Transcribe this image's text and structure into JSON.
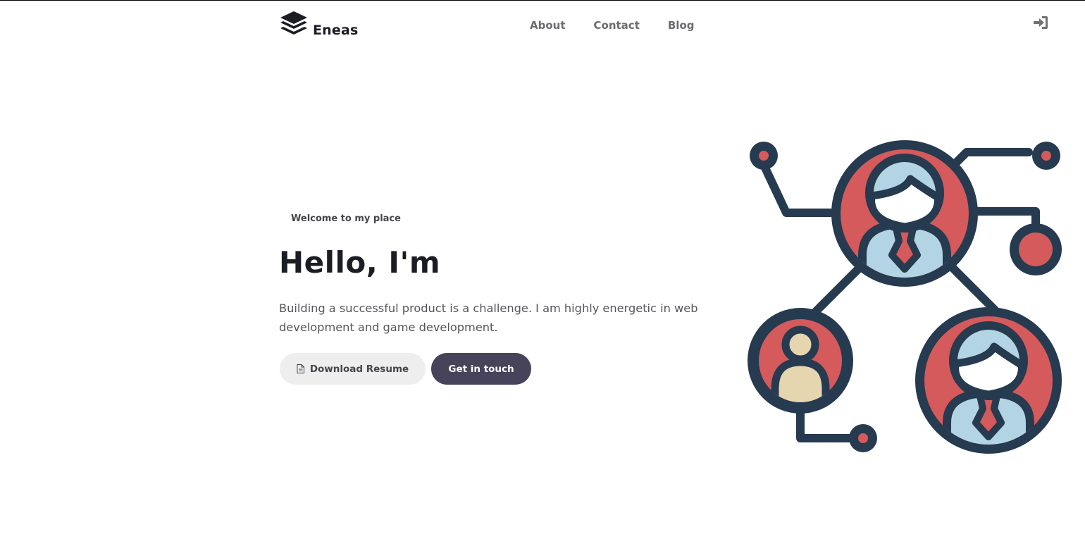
{
  "header": {
    "brand": "Eneas",
    "nav": [
      "About",
      "Contact",
      "Blog"
    ],
    "login_icon": "sign-in-icon"
  },
  "hero": {
    "eyebrow": "Welcome to my place",
    "headline": "Hello, I'm",
    "description": "Building a successful product is a challenge. I am highly energetic in web development and game development.",
    "buttons": {
      "resume": "Download Resume",
      "touch": "Get in touch"
    }
  },
  "colors": {
    "dark_navy": "#263a50",
    "red": "#d45a5c",
    "light_blue": "#b3d5e3",
    "beige": "#e5d6af",
    "button_dark": "#46435a",
    "button_light": "#eeeeef"
  },
  "icons": {
    "logo": "stack-layers-icon",
    "resume": "document-icon",
    "illustration": "people-network-illustration"
  }
}
